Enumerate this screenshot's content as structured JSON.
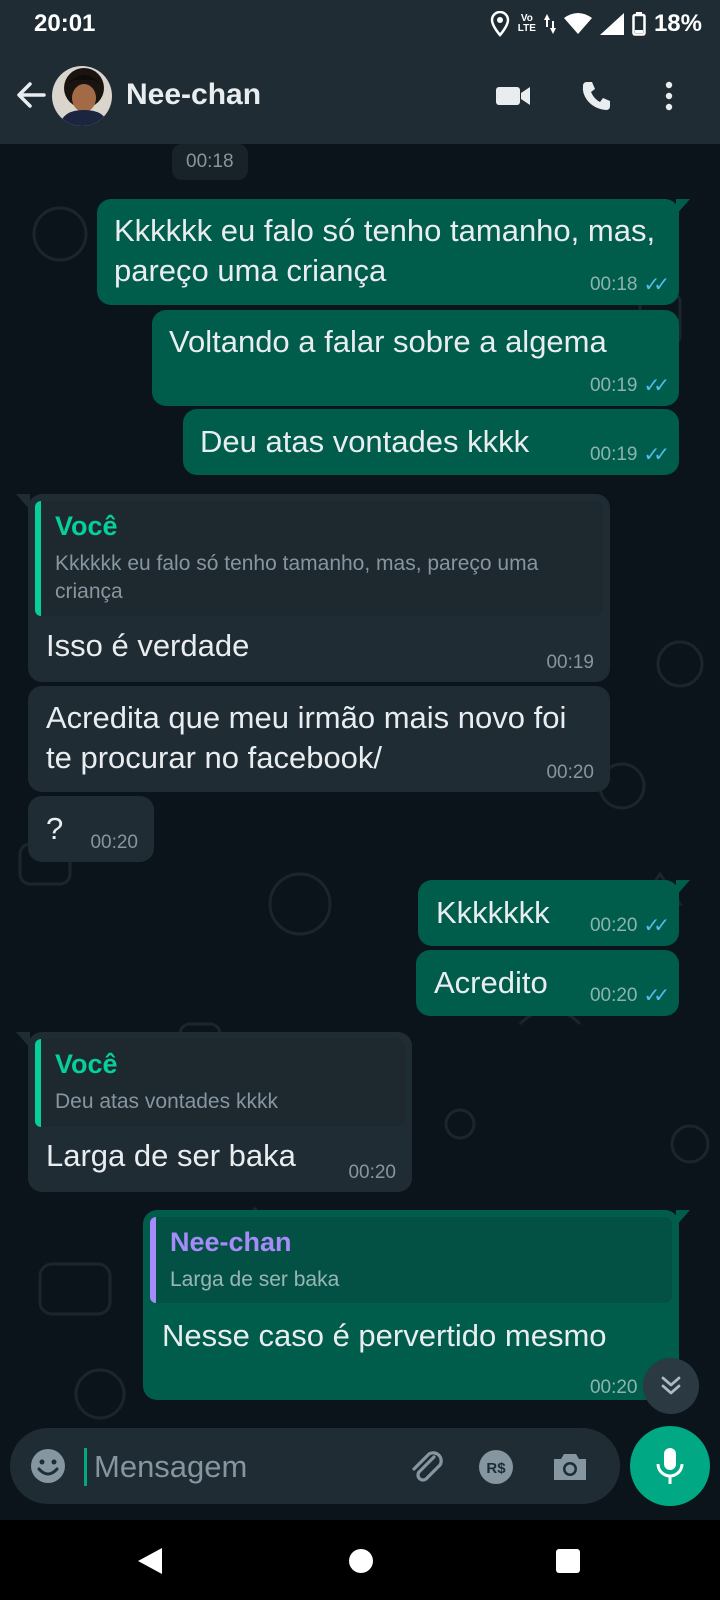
{
  "status_bar": {
    "time": "20:01",
    "volte_top": "Vo",
    "volte_bottom": "LTE",
    "battery": "18%"
  },
  "header": {
    "contact_name": "Nee-chan"
  },
  "chat": {
    "date_chip": "00:18",
    "messages": [
      {
        "text": "Kkkkkk eu falo só tenho tamanho, mas, pareço uma criança",
        "time": "00:18"
      },
      {
        "text": "Voltando a falar sobre a algema",
        "time": "00:19"
      },
      {
        "text": "Deu atas vontades kkkk",
        "time": "00:19"
      },
      {
        "quote_author": "Você",
        "quote_text": "Kkkkkk eu falo só tenho tamanho, mas, pareço uma criança",
        "text": "Isso é verdade",
        "time": "00:19"
      },
      {
        "text": "Acredita que meu irmão mais novo foi te procurar no facebook/",
        "time": "00:20"
      },
      {
        "text": "?",
        "time": "00:20"
      },
      {
        "text": "Kkkkkkk",
        "time": "00:20"
      },
      {
        "text": "Acredito",
        "time": "00:20"
      },
      {
        "quote_author": "Você",
        "quote_text": "Deu atas vontades kkkk",
        "text": "Larga de ser baka",
        "time": "00:20"
      },
      {
        "quote_author": "Nee-chan",
        "quote_text": "Larga de ser baka",
        "text": "Nesse caso é pervertido mesmo",
        "time": "00:20"
      }
    ]
  },
  "composer": {
    "placeholder": "Mensagem"
  },
  "colors": {
    "outgoing_bubble": "#005c4b",
    "incoming_bubble": "#202c33",
    "accent": "#00a884",
    "read_ticks": "#53bdeb",
    "header_bg": "#1f2c34"
  }
}
